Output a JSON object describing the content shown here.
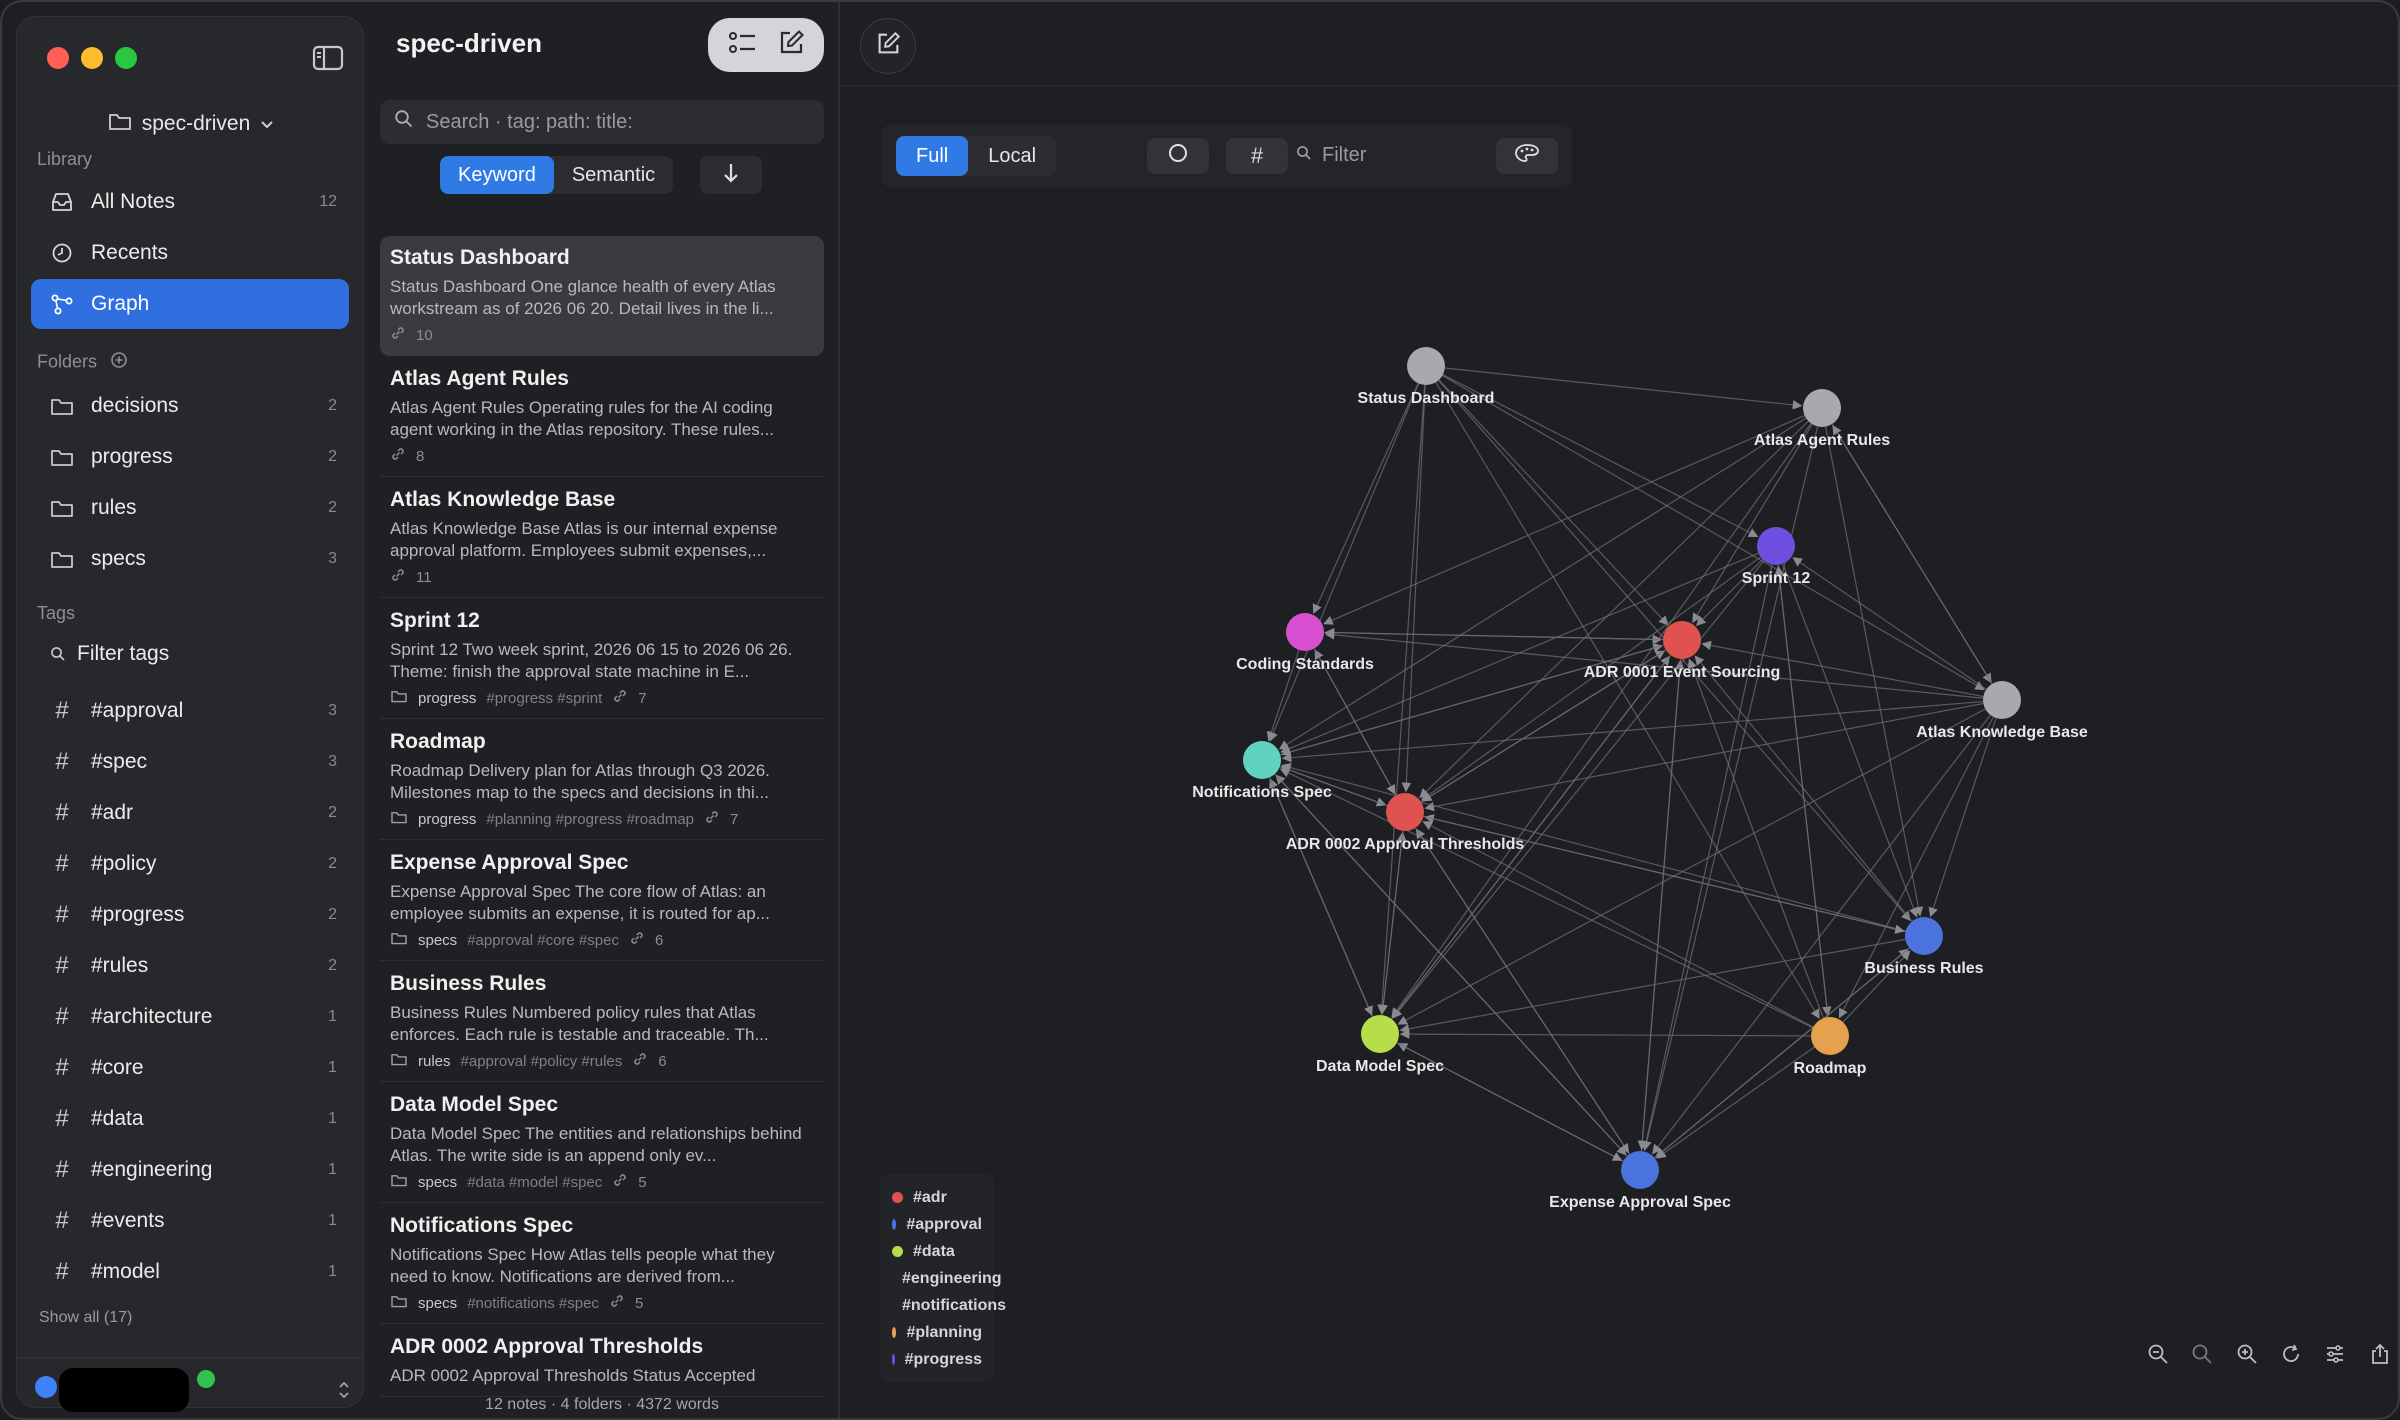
{
  "sidebar": {
    "vault_name": "spec-driven",
    "library_label": "Library",
    "library": [
      {
        "label": "All Notes",
        "count": "12"
      },
      {
        "label": "Recents",
        "count": ""
      },
      {
        "label": "Graph",
        "count": ""
      }
    ],
    "folders_label": "Folders",
    "folders": [
      {
        "label": "decisions",
        "count": "2"
      },
      {
        "label": "progress",
        "count": "2"
      },
      {
        "label": "rules",
        "count": "2"
      },
      {
        "label": "specs",
        "count": "3"
      }
    ],
    "tags_label": "Tags",
    "filter_tags_label": "Filter tags",
    "tags": [
      {
        "label": "#approval",
        "count": "3"
      },
      {
        "label": "#spec",
        "count": "3"
      },
      {
        "label": "#adr",
        "count": "2"
      },
      {
        "label": "#policy",
        "count": "2"
      },
      {
        "label": "#progress",
        "count": "2"
      },
      {
        "label": "#rules",
        "count": "2"
      },
      {
        "label": "#architecture",
        "count": "1"
      },
      {
        "label": "#core",
        "count": "1"
      },
      {
        "label": "#data",
        "count": "1"
      },
      {
        "label": "#engineering",
        "count": "1"
      },
      {
        "label": "#events",
        "count": "1"
      },
      {
        "label": "#model",
        "count": "1"
      }
    ],
    "show_all_label": "Show all (17)"
  },
  "notelist": {
    "title": "spec-driven",
    "search_placeholder": "Search  ·  tag: path: title:",
    "modes": [
      "Keyword",
      "Semantic"
    ],
    "notes": [
      {
        "title": "Status Dashboard",
        "snippet": "Status Dashboard One glance health of every Atlas workstream as of 2026 06 20. Detail lives in the li...",
        "folder": "",
        "tags": "",
        "links": "10"
      },
      {
        "title": "Atlas Agent Rules",
        "snippet": "Atlas Agent Rules Operating rules for the AI coding agent working in the Atlas repository. These rules...",
        "folder": "",
        "tags": "",
        "links": "8"
      },
      {
        "title": "Atlas Knowledge Base",
        "snippet": "Atlas Knowledge Base Atlas is our internal expense approval platform. Employees submit expenses,...",
        "folder": "",
        "tags": "",
        "links": "11"
      },
      {
        "title": "Sprint 12",
        "snippet": "Sprint 12 Two week sprint, 2026 06 15 to 2026 06 26. Theme: finish the approval state machine in E...",
        "folder": "progress",
        "tags": "#progress #sprint",
        "links": "7"
      },
      {
        "title": "Roadmap",
        "snippet": "Roadmap Delivery plan for Atlas through Q3 2026. Milestones map to the specs and decisions in thi...",
        "folder": "progress",
        "tags": "#planning #progress #roadmap",
        "links": "7"
      },
      {
        "title": "Expense Approval Spec",
        "snippet": "Expense Approval Spec The core flow of Atlas: an employee submits an expense, it is routed for ap...",
        "folder": "specs",
        "tags": "#approval #core #spec",
        "links": "6"
      },
      {
        "title": "Business Rules",
        "snippet": "Business Rules Numbered policy rules that Atlas enforces. Each rule is testable and traceable. Th...",
        "folder": "rules",
        "tags": "#approval #policy #rules",
        "links": "6"
      },
      {
        "title": "Data Model Spec",
        "snippet": "Data Model Spec The entities and relationships behind Atlas. The write side is an append only ev...",
        "folder": "specs",
        "tags": "#data #model #spec",
        "links": "5"
      },
      {
        "title": "Notifications Spec",
        "snippet": "Notifications Spec How Atlas tells people what they need to know. Notifications are derived from...",
        "folder": "specs",
        "tags": "#notifications #spec",
        "links": "5"
      },
      {
        "title": "ADR 0002 Approval Thresholds",
        "snippet": "ADR 0002 Approval Thresholds Status Accepted",
        "folder": "",
        "tags": "",
        "links": ""
      }
    ],
    "footer": "12 notes  ·  4 folders  ·  4372 words"
  },
  "graph": {
    "scopes": [
      "Full",
      "Local"
    ],
    "filter_placeholder": "Filter",
    "nodes": [
      {
        "id": "status",
        "label": "Status Dashboard",
        "color": "#a8a9ad"
      },
      {
        "id": "agent",
        "label": "Atlas Agent Rules",
        "color": "#a8a9ad"
      },
      {
        "id": "sprint",
        "label": "Sprint 12",
        "color": "#6f4fe0"
      },
      {
        "id": "coding",
        "label": "Coding Standards",
        "color": "#d64fd0"
      },
      {
        "id": "adr1",
        "label": "ADR 0001 Event Sourcing",
        "color": "#e0524f"
      },
      {
        "id": "kb",
        "label": "Atlas Knowledge Base",
        "color": "#a8a9ad"
      },
      {
        "id": "notif",
        "label": "Notifications Spec",
        "color": "#5fd3c0"
      },
      {
        "id": "adr2",
        "label": "ADR 0002 Approval Thresholds",
        "color": "#e0524f"
      },
      {
        "id": "rules",
        "label": "Business Rules",
        "color": "#4a73e0"
      },
      {
        "id": "data",
        "label": "Data Model Spec",
        "color": "#b6dd4a"
      },
      {
        "id": "roadmap",
        "label": "Roadmap",
        "color": "#e6a14e"
      },
      {
        "id": "expense",
        "label": "Expense Approval Spec",
        "color": "#4a73e0"
      }
    ],
    "edges": [
      [
        "status",
        "agent"
      ],
      [
        "status",
        "sprint"
      ],
      [
        "status",
        "coding"
      ],
      [
        "status",
        "adr1"
      ],
      [
        "status",
        "kb"
      ],
      [
        "status",
        "notif"
      ],
      [
        "status",
        "adr2"
      ],
      [
        "status",
        "rules"
      ],
      [
        "status",
        "data"
      ],
      [
        "status",
        "roadmap"
      ],
      [
        "agent",
        "coding"
      ],
      [
        "agent",
        "adr1"
      ],
      [
        "agent",
        "notif"
      ],
      [
        "agent",
        "adr2"
      ],
      [
        "agent",
        "rules"
      ],
      [
        "agent",
        "data"
      ],
      [
        "agent",
        "expense"
      ],
      [
        "agent",
        "kb"
      ],
      [
        "kb",
        "adr1"
      ],
      [
        "kb",
        "adr2"
      ],
      [
        "kb",
        "notif"
      ],
      [
        "kb",
        "rules"
      ],
      [
        "kb",
        "data"
      ],
      [
        "kb",
        "expense"
      ],
      [
        "kb",
        "coding"
      ],
      [
        "kb",
        "sprint"
      ],
      [
        "kb",
        "roadmap"
      ],
      [
        "kb",
        "agent"
      ],
      [
        "sprint",
        "adr1"
      ],
      [
        "sprint",
        "expense"
      ],
      [
        "sprint",
        "rules"
      ],
      [
        "sprint",
        "roadmap"
      ],
      [
        "sprint",
        "data"
      ],
      [
        "sprint",
        "notif"
      ],
      [
        "sprint",
        "adr2"
      ],
      [
        "roadmap",
        "adr1"
      ],
      [
        "roadmap",
        "adr2"
      ],
      [
        "roadmap",
        "expense"
      ],
      [
        "roadmap",
        "data"
      ],
      [
        "roadmap",
        "notif"
      ],
      [
        "roadmap",
        "rules"
      ],
      [
        "roadmap",
        "sprint"
      ],
      [
        "expense",
        "adr1"
      ],
      [
        "expense",
        "adr2"
      ],
      [
        "expense",
        "notif"
      ],
      [
        "expense",
        "rules"
      ],
      [
        "expense",
        "data"
      ],
      [
        "rules",
        "adr1"
      ],
      [
        "rules",
        "adr2"
      ],
      [
        "rules",
        "expense"
      ],
      [
        "rules",
        "notif"
      ],
      [
        "rules",
        "data"
      ],
      [
        "data",
        "adr1"
      ],
      [
        "data",
        "adr2"
      ],
      [
        "data",
        "notif"
      ],
      [
        "data",
        "expense"
      ],
      [
        "notif",
        "adr1"
      ],
      [
        "notif",
        "adr2"
      ],
      [
        "notif",
        "expense"
      ],
      [
        "notif",
        "data"
      ],
      [
        "adr2",
        "adr1"
      ],
      [
        "adr2",
        "coding"
      ],
      [
        "adr2",
        "notif"
      ],
      [
        "adr2",
        "expense"
      ],
      [
        "adr2",
        "rules"
      ],
      [
        "adr2",
        "data"
      ],
      [
        "coding",
        "adr1"
      ],
      [
        "coding",
        "notif"
      ],
      [
        "coding",
        "adr2"
      ],
      [
        "adr1",
        "coding"
      ],
      [
        "adr1",
        "notif"
      ],
      [
        "adr1",
        "adr2"
      ],
      [
        "adr1",
        "expense"
      ],
      [
        "adr1",
        "data"
      ]
    ],
    "legend": [
      {
        "label": "#adr",
        "color": "#e0524f"
      },
      {
        "label": "#approval",
        "color": "#4a73e0"
      },
      {
        "label": "#data",
        "color": "#b6dd4a"
      },
      {
        "label": "#engineering",
        "color": "#d64fd0"
      },
      {
        "label": "#notifications",
        "color": "#5fd3c0"
      },
      {
        "label": "#planning",
        "color": "#e6a14e"
      },
      {
        "label": "#progress",
        "color": "#6f4fe0"
      }
    ]
  }
}
